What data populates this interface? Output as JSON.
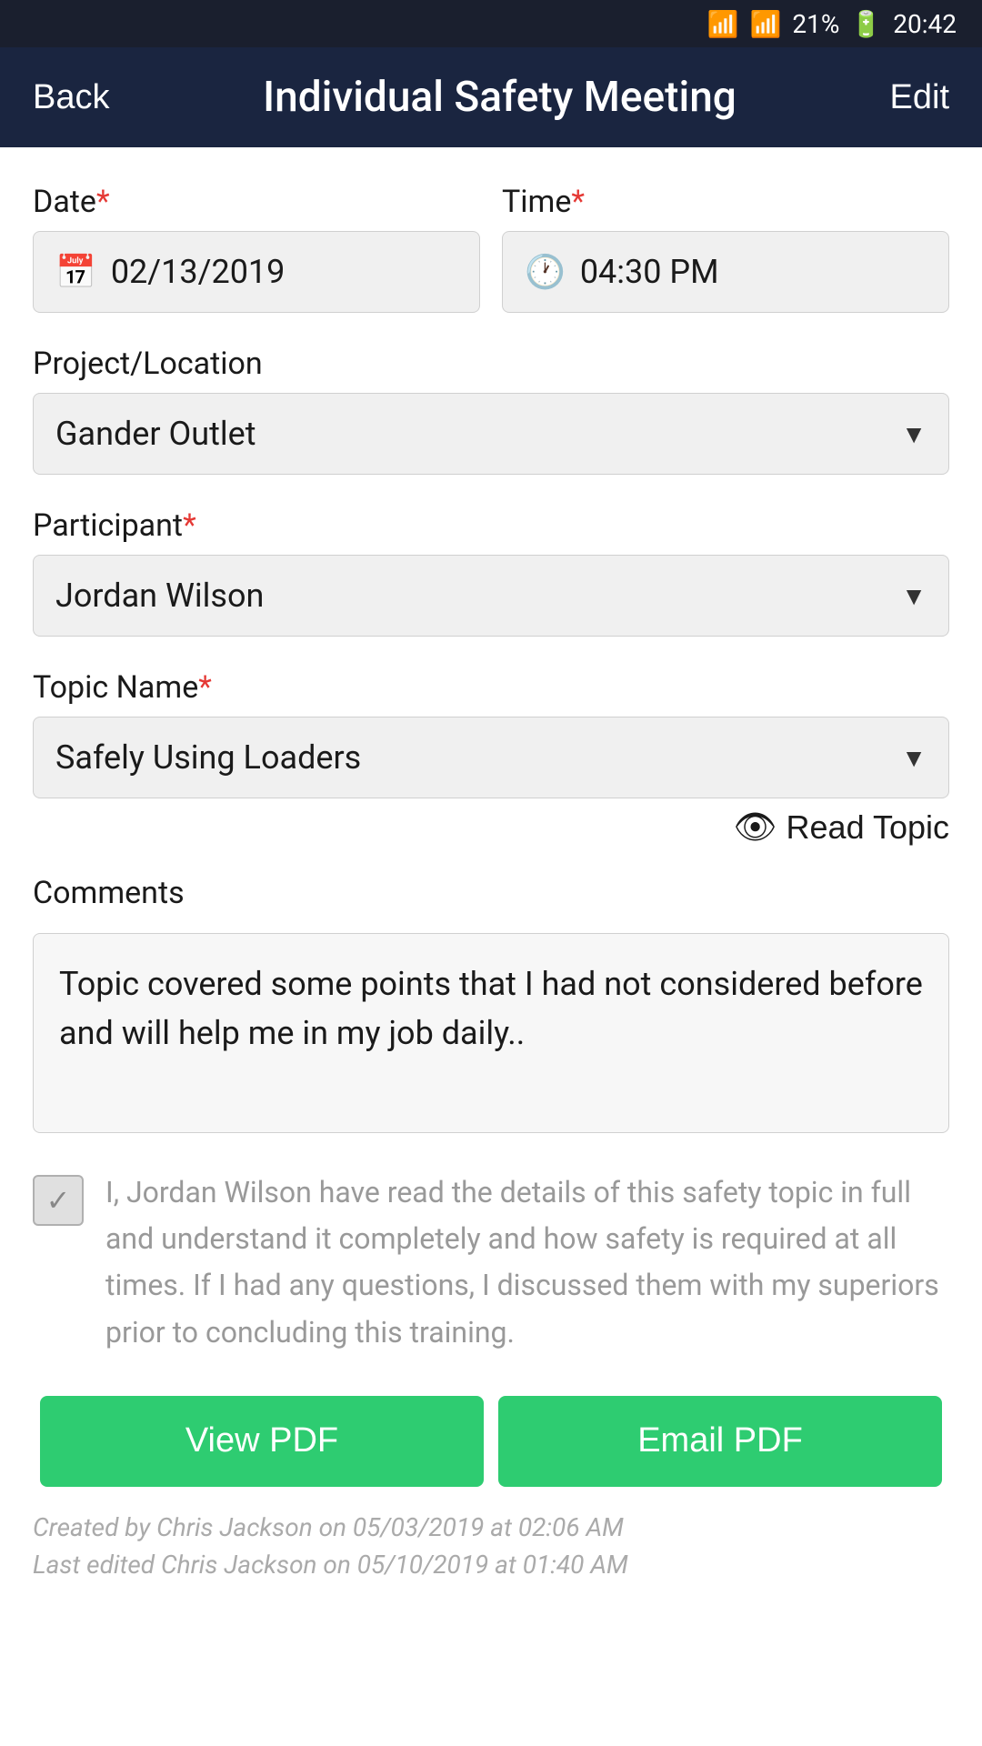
{
  "statusBar": {
    "wifi": "wifi",
    "signal": "signal",
    "battery": "21%",
    "time": "20:42"
  },
  "header": {
    "back_label": "Back",
    "title": "Individual Safety Meeting",
    "edit_label": "Edit"
  },
  "form": {
    "date_label": "Date",
    "date_value": "02/13/2019",
    "time_label": "Time",
    "time_value": "04:30 PM",
    "project_label": "Project/Location",
    "project_value": "Gander Outlet",
    "participant_label": "Participant",
    "participant_value": "Jordan Wilson",
    "topic_label": "Topic Name",
    "topic_value": "Safely Using Loaders",
    "read_topic_label": "Read Topic",
    "comments_label": "Comments",
    "comments_value": "Topic covered some points that I had not considered before and will help me in my job daily.."
  },
  "consent": {
    "text": "I, Jordan Wilson have read the details of this safety topic in full and understand it completely and how safety is required at all times. If I had any questions, I discussed them with my superiors prior to concluding this training."
  },
  "buttons": {
    "view_pdf": "View PDF",
    "email_pdf": "Email PDF"
  },
  "footer": {
    "created": "Created by Chris Jackson on 05/03/2019 at 02:06 AM",
    "edited": "Last edited Chris Jackson on 05/10/2019 at 01:40 AM"
  },
  "colors": {
    "required_star": "#e53935",
    "green_btn": "#2ecc71",
    "header_bg": "#1a2540"
  }
}
